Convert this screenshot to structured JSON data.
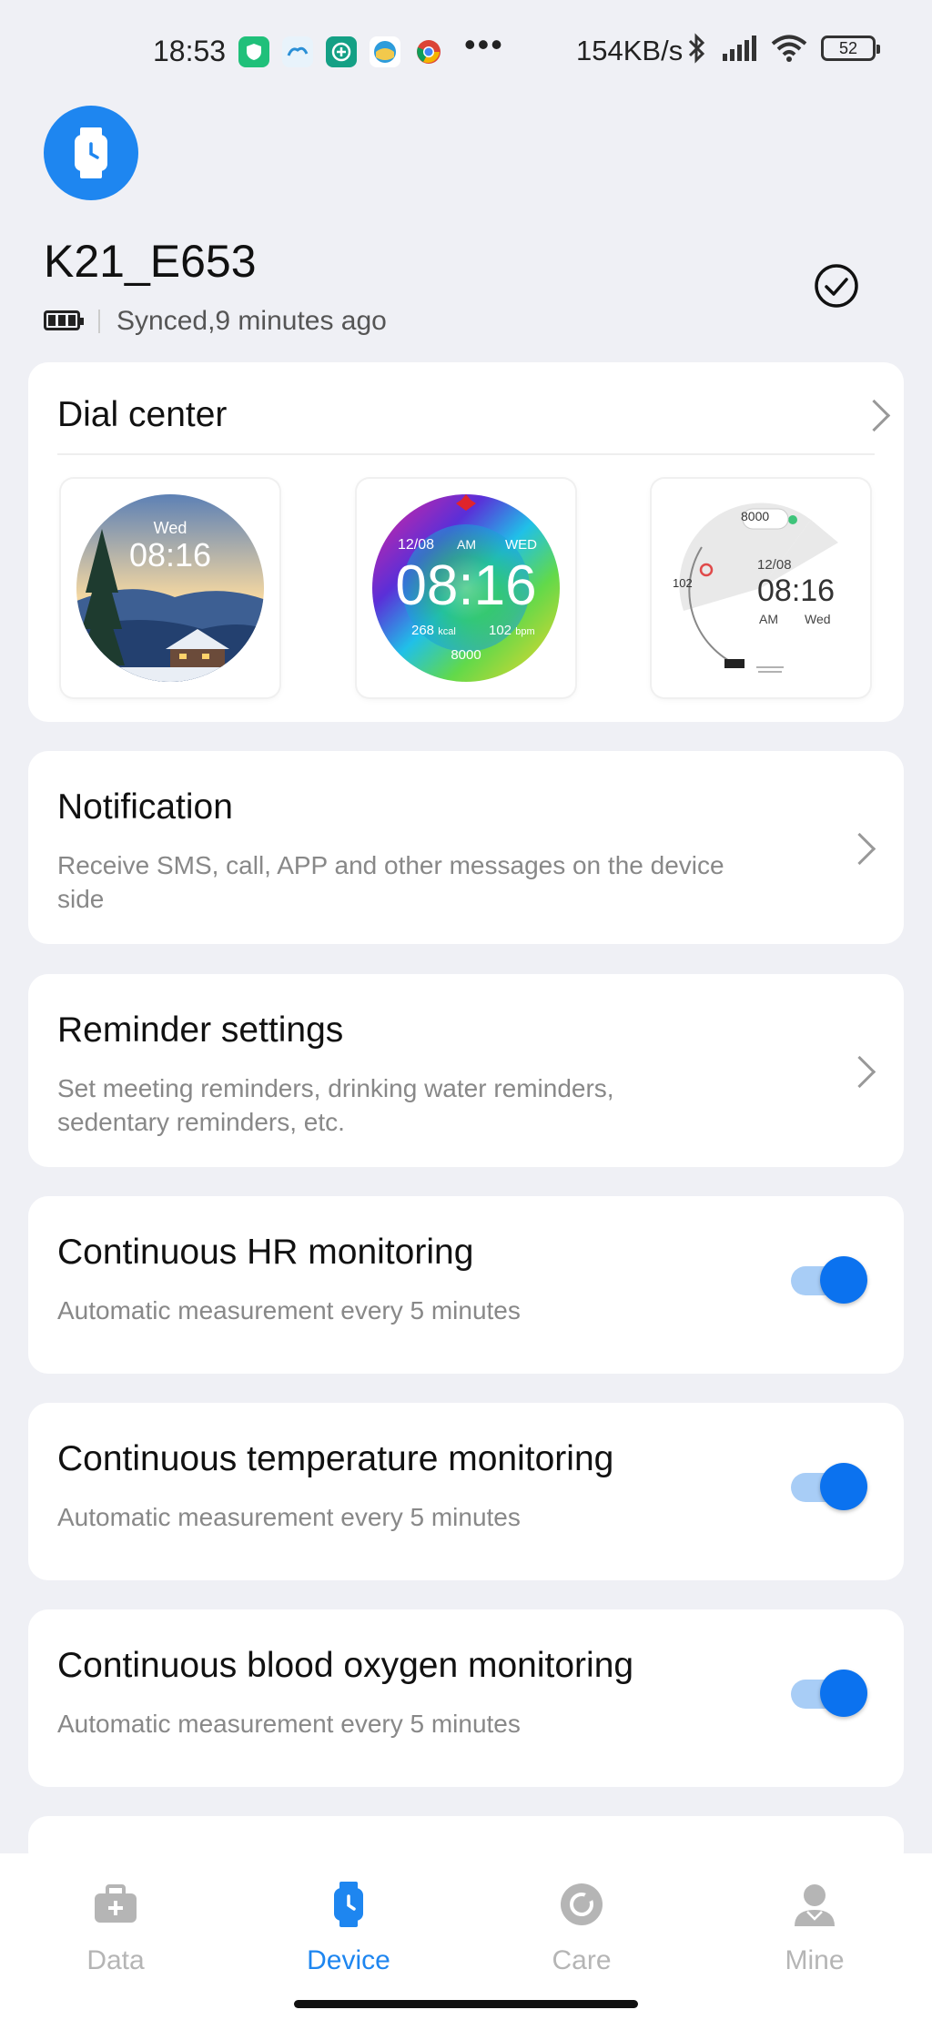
{
  "status_bar": {
    "time": "18:53",
    "net_speed": "154KB/s",
    "battery": "52",
    "more": "•••"
  },
  "device": {
    "name": "K21_E653",
    "sync_status": "Synced,9 minutes ago"
  },
  "dial_center": {
    "title": "Dial center",
    "dials": [
      {
        "day": "Wed",
        "time": "08:16"
      },
      {
        "date": "12/08",
        "ampm": "AM",
        "day": "WED",
        "time": "08:16",
        "kcal": "268",
        "kcal_unit": "kcal",
        "bpm": "102",
        "bpm_unit": "bpm",
        "steps": "8000"
      },
      {
        "steps": "8000",
        "hr": "102",
        "date": "12/08",
        "time": "08:16",
        "ampm": "AM",
        "day": "Wed"
      }
    ]
  },
  "settings": [
    {
      "title": "Notification",
      "subtitle": "Receive SMS, call, APP and other messages on the device side"
    },
    {
      "title": "Reminder settings",
      "subtitle": "Set meeting reminders, drinking water reminders, sedentary reminders, etc."
    },
    {
      "title": "Continuous HR monitoring",
      "subtitle": "Automatic measurement every 5 minutes",
      "enabled": true
    },
    {
      "title": "Continuous temperature monitoring",
      "subtitle": "Automatic measurement every 5 minutes",
      "enabled": true
    },
    {
      "title": "Continuous blood oxygen monitoring",
      "subtitle": "Automatic measurement every 5 minutes",
      "enabled": true
    }
  ],
  "nav": {
    "items": [
      {
        "label": "Data",
        "icon": "medical-kit-icon"
      },
      {
        "label": "Device",
        "icon": "watch-icon",
        "active": true
      },
      {
        "label": "Care",
        "icon": "care-icon"
      },
      {
        "label": "Mine",
        "icon": "user-icon"
      }
    ]
  },
  "colors": {
    "accent": "#1e86f0",
    "toggle_on": "#0b72ef",
    "background": "#eff0f5"
  }
}
